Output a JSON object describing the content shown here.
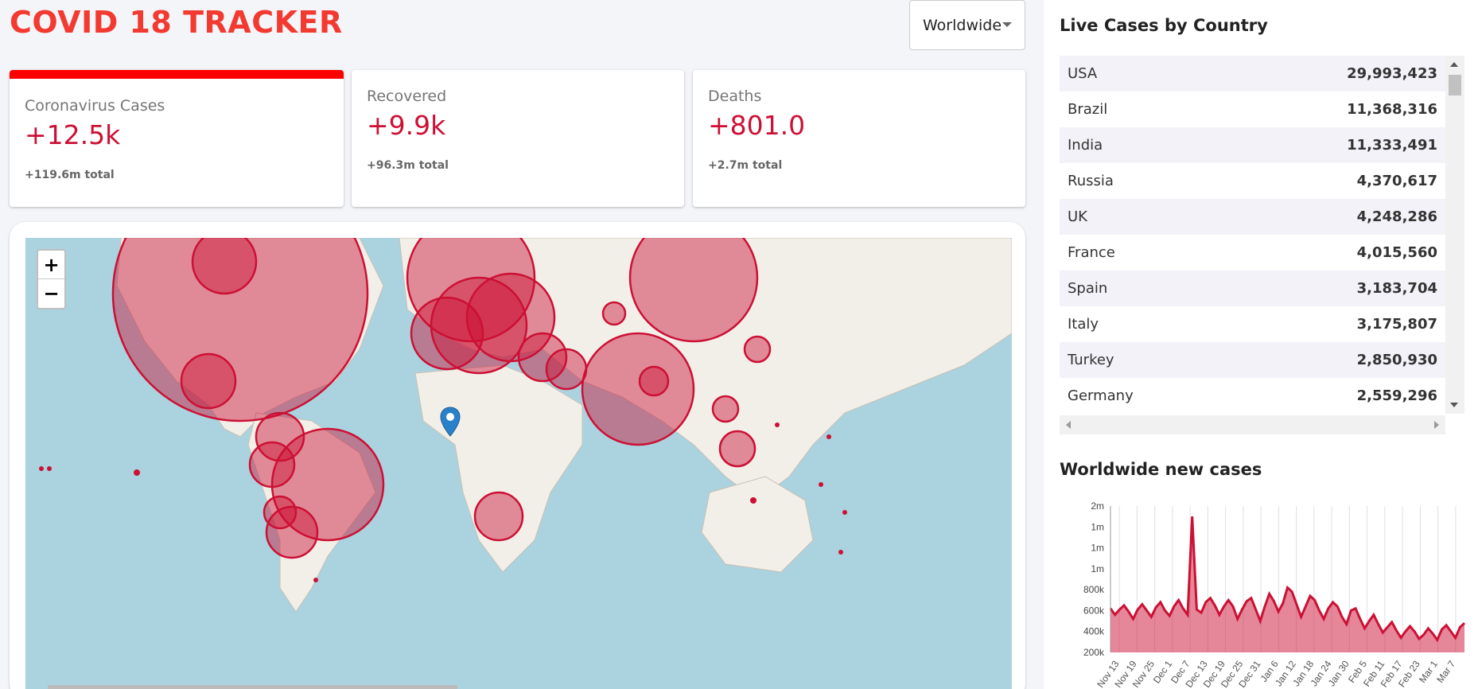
{
  "header": {
    "title": "COVID 18 TRACKER",
    "country_select": "Worldwide"
  },
  "stats": [
    {
      "title": "Coronavirus Cases",
      "value": "+12.5k",
      "total": "+119.6m total",
      "active": true
    },
    {
      "title": "Recovered",
      "value": "+9.9k",
      "total": "+96.3m total",
      "active": false
    },
    {
      "title": "Deaths",
      "value": "+801.0",
      "total": "+2.7m total",
      "active": false
    }
  ],
  "map": {
    "zoom_in": "+",
    "zoom_out": "−",
    "circle_color": "#cc1034",
    "marker_color": "#2a81cb"
  },
  "live_cases": {
    "title": "Live Cases by Country",
    "rows": [
      {
        "country": "USA",
        "cases": "29,993,423"
      },
      {
        "country": "Brazil",
        "cases": "11,368,316"
      },
      {
        "country": "India",
        "cases": "11,333,491"
      },
      {
        "country": "Russia",
        "cases": "4,370,617"
      },
      {
        "country": "UK",
        "cases": "4,248,286"
      },
      {
        "country": "France",
        "cases": "4,015,560"
      },
      {
        "country": "Spain",
        "cases": "3,183,704"
      },
      {
        "country": "Italy",
        "cases": "3,175,807"
      },
      {
        "country": "Turkey",
        "cases": "2,850,930"
      },
      {
        "country": "Germany",
        "cases": "2,559,296"
      }
    ]
  },
  "chart_title": "Worldwide new cases",
  "chart_data": {
    "type": "area",
    "title": "",
    "xlabel": "",
    "ylabel": "",
    "ytick_labels": [
      "2m",
      "1m",
      "1m",
      "1m",
      "800k",
      "600k",
      "400k",
      "200k"
    ],
    "xtick_labels": [
      "Nov 13",
      "Nov 19",
      "Nov 25",
      "Dec 1",
      "Dec 7",
      "Dec 13",
      "Dec 19",
      "Dec 25",
      "Dec 31",
      "Jan 6",
      "Jan 12",
      "Jan 18",
      "Jan 24",
      "Jan 30",
      "Feb 5",
      "Feb 11",
      "Feb 17",
      "Feb 23",
      "Mar 1",
      "Mar 7"
    ],
    "ylim": [
      200000,
      1600000
    ],
    "values": [
      620000,
      560000,
      610000,
      650000,
      590000,
      520000,
      610000,
      660000,
      600000,
      540000,
      630000,
      680000,
      600000,
      550000,
      640000,
      700000,
      620000,
      560000,
      1500000,
      610000,
      580000,
      680000,
      720000,
      650000,
      560000,
      640000,
      700000,
      640000,
      520000,
      610000,
      690000,
      720000,
      610000,
      500000,
      640000,
      760000,
      690000,
      590000,
      670000,
      820000,
      780000,
      660000,
      540000,
      640000,
      740000,
      700000,
      600000,
      520000,
      620000,
      680000,
      640000,
      540000,
      470000,
      600000,
      620000,
      520000,
      430000,
      500000,
      560000,
      470000,
      390000,
      440000,
      490000,
      410000,
      340000,
      400000,
      450000,
      400000,
      330000,
      370000,
      430000,
      380000,
      320000,
      420000,
      460000,
      400000,
      340000,
      440000,
      480000
    ],
    "line_color": "#cc1034",
    "fill_color": "rgba(204,16,52,0.5)"
  }
}
